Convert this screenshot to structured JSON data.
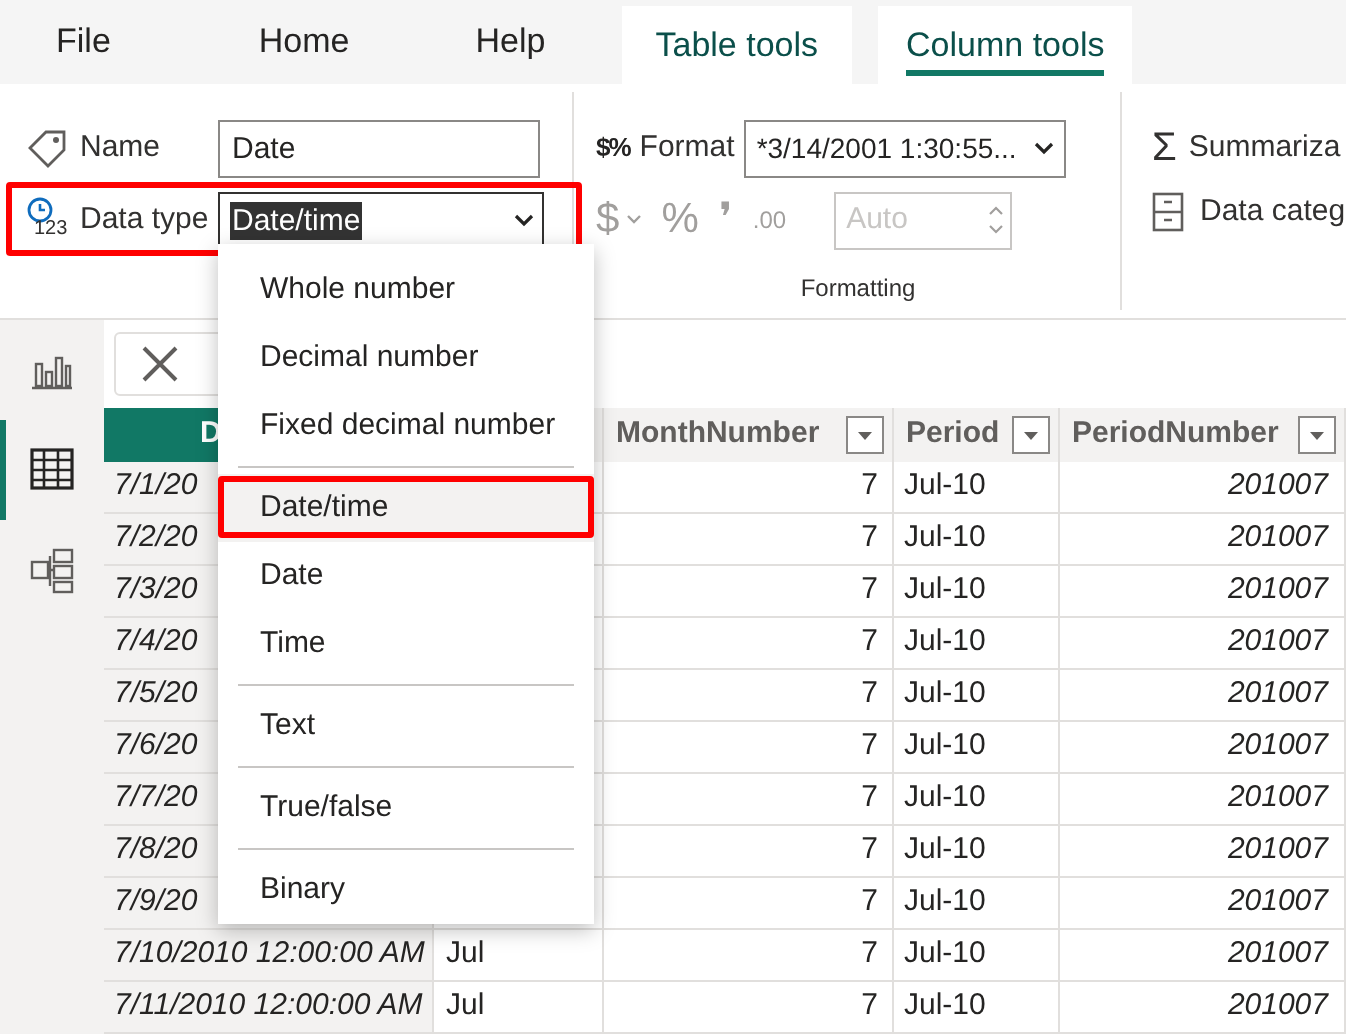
{
  "menu_tabs": [
    {
      "label": "File",
      "kind": "plain",
      "selected": false
    },
    {
      "label": "Home",
      "kind": "plain",
      "selected": false
    },
    {
      "label": "Help",
      "kind": "plain",
      "selected": false
    },
    {
      "label": "Table tools",
      "kind": "contextual",
      "selected": false
    },
    {
      "label": "Column tools",
      "kind": "contextual",
      "selected": true
    }
  ],
  "ribbon": {
    "name": {
      "label": "Name",
      "value": "Date"
    },
    "data_type": {
      "label": "Data type",
      "icon_label": "123",
      "value": "Date/time",
      "highlighted": true
    },
    "formatting": {
      "group_label": "Formatting",
      "format_icon_label": "$%",
      "format_label": "Format",
      "format_value": "*3/14/2001 1:30:55...",
      "buttons": [
        {
          "label": "$",
          "has_caret": true,
          "disabled": true
        },
        {
          "label": "%",
          "has_caret": false,
          "disabled": true
        },
        {
          "label": "❜",
          "has_caret": false,
          "disabled": true
        },
        {
          "label": ".00",
          "has_caret": false,
          "disabled": true
        }
      ],
      "decimals": {
        "placeholder": "Auto",
        "disabled": true
      }
    },
    "properties": {
      "summarization_icon": "Σ",
      "summarization_label": "Summariza",
      "category_label": "Data categ"
    }
  },
  "nav": [
    {
      "kind": "report",
      "selected": false
    },
    {
      "kind": "table",
      "selected": true
    },
    {
      "kind": "model",
      "selected": false
    }
  ],
  "table": {
    "columns": [
      {
        "label": "D",
        "selected": true
      },
      {
        "selected": false
      },
      {
        "label": "MonthNumber",
        "selected": false
      },
      {
        "label": "Period",
        "selected": false
      },
      {
        "label": "PeriodNumber",
        "selected": false
      }
    ],
    "rows": [
      [
        "7/1/20",
        null,
        "7",
        "Jul-10",
        "201007"
      ],
      [
        "7/2/20",
        null,
        "7",
        "Jul-10",
        "201007"
      ],
      [
        "7/3/20",
        null,
        "7",
        "Jul-10",
        "201007"
      ],
      [
        "7/4/20",
        null,
        "7",
        "Jul-10",
        "201007"
      ],
      [
        "7/5/20",
        null,
        "7",
        "Jul-10",
        "201007"
      ],
      [
        "7/6/20",
        null,
        "7",
        "Jul-10",
        "201007"
      ],
      [
        "7/7/20",
        null,
        "7",
        "Jul-10",
        "201007"
      ],
      [
        "7/8/20",
        null,
        "7",
        "Jul-10",
        "201007"
      ],
      [
        "7/9/20",
        null,
        "7",
        "Jul-10",
        "201007"
      ],
      [
        "7/10/2010 12:00:00 AM",
        "Jul",
        "7",
        "Jul-10",
        "201007"
      ],
      [
        "7/11/2010 12:00:00 AM",
        "Jul",
        "7",
        "Jul-10",
        "201007"
      ]
    ]
  },
  "data_type_menu": [
    {
      "label": "Whole number",
      "selected": false,
      "highlighted": false,
      "divider_after": false
    },
    {
      "label": "Decimal number",
      "selected": false,
      "highlighted": false,
      "divider_after": false
    },
    {
      "label": "Fixed decimal number",
      "selected": false,
      "highlighted": false,
      "divider_after": true
    },
    {
      "label": "Date/time",
      "selected": true,
      "highlighted": true,
      "divider_after": false
    },
    {
      "label": "Date",
      "selected": false,
      "highlighted": false,
      "divider_after": false
    },
    {
      "label": "Time",
      "selected": false,
      "highlighted": false,
      "divider_after": true
    },
    {
      "label": "Text",
      "selected": false,
      "highlighted": false,
      "divider_after": true
    },
    {
      "label": "True/false",
      "selected": false,
      "highlighted": false,
      "divider_after": true
    },
    {
      "label": "Binary",
      "selected": false,
      "highlighted": false,
      "divider_after": false
    }
  ]
}
